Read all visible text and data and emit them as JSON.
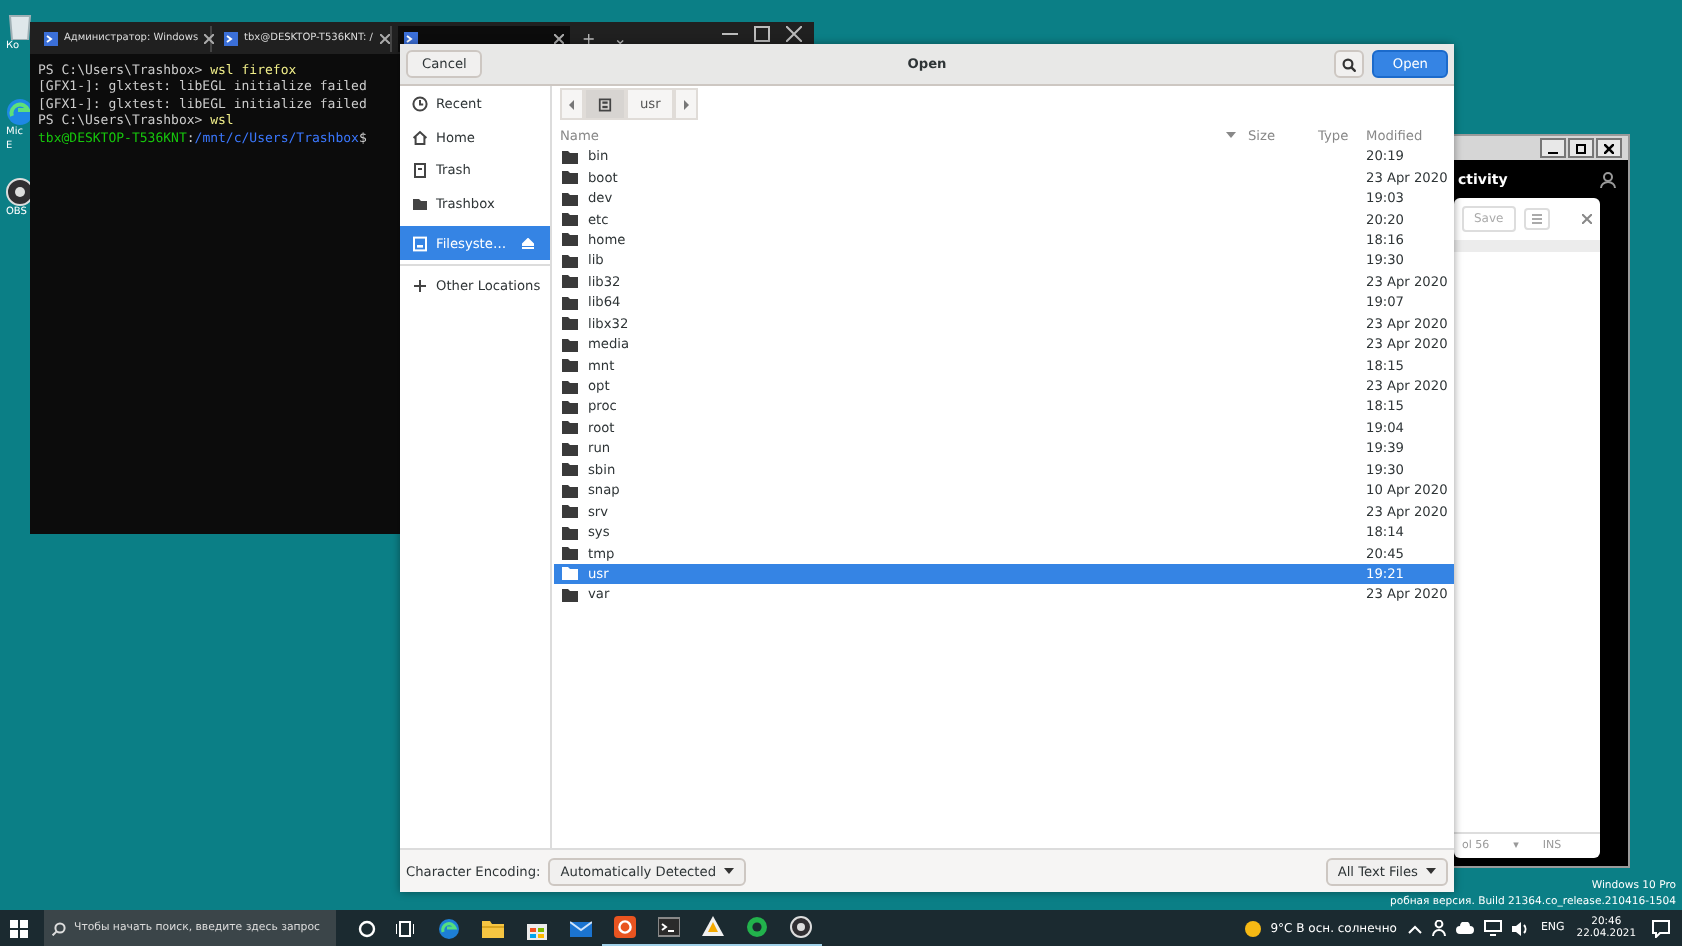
{
  "desktop_icons": [
    {
      "kind": "bin",
      "label_lines": [
        "Ко"
      ]
    },
    {
      "kind": "browser",
      "label_lines": [
        "Mic",
        "E"
      ]
    },
    {
      "kind": "recorder",
      "label_lines": [
        "OBS"
      ]
    }
  ],
  "terminal": {
    "tabs": [
      {
        "title": "Администратор: Windows",
        "selected": false
      },
      {
        "title": "tbx@DESKTOP-T536KNT: /",
        "selected": false
      },
      {
        "selected": true
      }
    ],
    "new_tab": "+",
    "tab_menu": "⌄",
    "lines": [
      [
        {
          "kind": "plain",
          "text": "PS C:\\Users\\Trashbox> "
        },
        {
          "kind": "command",
          "text": "wsl firefox"
        }
      ],
      [
        {
          "kind": "plain",
          "text": "[GFX1-]: glxtest: libEGL initialize failed"
        }
      ],
      [
        {
          "kind": "plain",
          "text": "[GFX1-]: glxtest: libEGL initialize failed"
        }
      ],
      [
        {
          "kind": "plain",
          "text": "PS C:\\Users\\Trashbox> "
        },
        {
          "kind": "command",
          "text": "wsl"
        }
      ],
      [
        {
          "kind": "user",
          "text": "tbx@DESKTOP-T536KNT"
        },
        {
          "kind": "plain",
          "text": ":"
        },
        {
          "kind": "path",
          "text": "/mnt/c/Users/Trashbox"
        },
        {
          "kind": "plain",
          "text": "$"
        }
      ]
    ]
  },
  "background_window": {
    "title": "ctivity",
    "save": "Save",
    "status": [
      "ol 56",
      "▾",
      "INS"
    ]
  },
  "dialog": {
    "title": "Open",
    "cancel": "Cancel",
    "open": "Open",
    "sidebar": [
      {
        "kind": "recent",
        "label": "Recent",
        "selected": false
      },
      {
        "kind": "home",
        "label": "Home",
        "selected": false
      },
      {
        "kind": "trash",
        "label": "Trash",
        "selected": false
      },
      {
        "kind": "folder",
        "label": "Trashbox",
        "selected": false
      },
      {
        "kind": "drive",
        "label": "Filesyste…",
        "selected": true
      },
      {
        "kind": "action",
        "label": "Other Locations",
        "selected": false
      }
    ],
    "path": [
      {
        "kind": "drive",
        "selected": true
      },
      {
        "kind": "folder",
        "label": "usr",
        "selected": false
      }
    ],
    "columns": [
      "Name",
      "Size",
      "Type",
      "Modified"
    ],
    "rows": [
      {
        "name": "bin",
        "modified": "20:19",
        "selected": false
      },
      {
        "name": "boot",
        "modified": "23 Apr 2020",
        "selected": false
      },
      {
        "name": "dev",
        "modified": "19:03",
        "selected": false
      },
      {
        "name": "etc",
        "modified": "20:20",
        "selected": false
      },
      {
        "name": "home",
        "modified": "18:16",
        "selected": false
      },
      {
        "name": "lib",
        "modified": "19:30",
        "selected": false
      },
      {
        "name": "lib32",
        "modified": "23 Apr 2020",
        "selected": false
      },
      {
        "name": "lib64",
        "modified": "19:07",
        "selected": false
      },
      {
        "name": "libx32",
        "modified": "23 Apr 2020",
        "selected": false
      },
      {
        "name": "media",
        "modified": "23 Apr 2020",
        "selected": false
      },
      {
        "name": "mnt",
        "modified": "18:15",
        "selected": false
      },
      {
        "name": "opt",
        "modified": "23 Apr 2020",
        "selected": false
      },
      {
        "name": "proc",
        "modified": "18:15",
        "selected": false
      },
      {
        "name": "root",
        "modified": "19:04",
        "selected": false
      },
      {
        "name": "run",
        "modified": "19:39",
        "selected": false
      },
      {
        "name": "sbin",
        "modified": "19:30",
        "selected": false
      },
      {
        "name": "snap",
        "modified": "10 Apr 2020",
        "selected": false
      },
      {
        "name": "srv",
        "modified": "23 Apr 2020",
        "selected": false
      },
      {
        "name": "sys",
        "modified": "18:14",
        "selected": false
      },
      {
        "name": "tmp",
        "modified": "20:45",
        "selected": false
      },
      {
        "name": "usr",
        "modified": "19:21",
        "selected": true
      },
      {
        "name": "var",
        "modified": "23 Apr 2020",
        "selected": false
      }
    ],
    "encoding_label": "Character Encoding:",
    "encoding": "Automatically Detected",
    "filter": "All Text Files"
  },
  "watermark_os": "Windows 10 Pro",
  "watermark_build": "робная версия. Build 21364.co_release.210416-1504",
  "taskbar": {
    "search_placeholder": "Чтобы начать поиск, введите здесь запрос",
    "apps": [
      {
        "kind": "browser",
        "running": false
      },
      {
        "kind": "folder",
        "running": false
      },
      {
        "kind": "store",
        "running": false
      },
      {
        "kind": "mail",
        "running": false
      },
      {
        "kind": "ubuntu",
        "running": true
      },
      {
        "kind": "terminal",
        "running": true
      },
      {
        "kind": "cone",
        "running": true
      },
      {
        "kind": "green",
        "running": true
      },
      {
        "kind": "recorder",
        "running": true
      }
    ],
    "weather": "9°C  В осн. солнечно",
    "language": "ENG",
    "time": "20:46",
    "date": "22.04.2021"
  }
}
